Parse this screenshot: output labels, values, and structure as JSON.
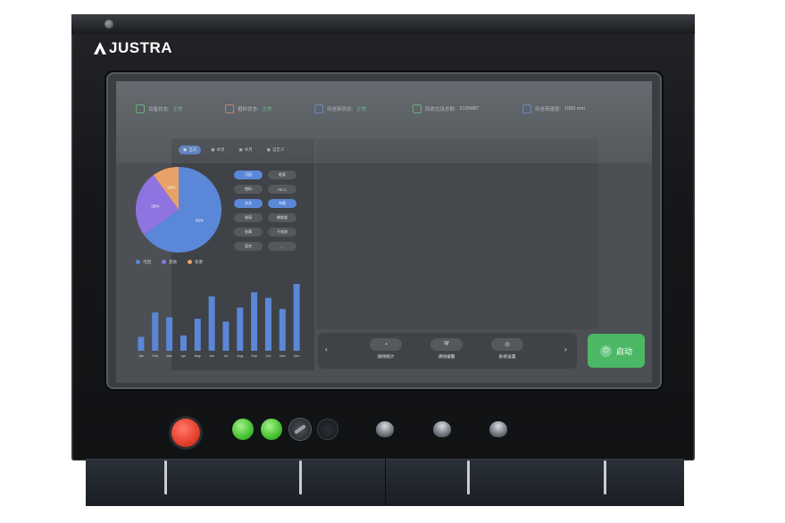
{
  "brand": {
    "logo_text": "JUSTRA"
  },
  "status_bar": [
    {
      "label": "设备状态:",
      "value": "正常",
      "icon": "device-icon",
      "icon_color": "#5ac26c",
      "value_style": "ok"
    },
    {
      "label": "粗料状态:",
      "value": "正常",
      "icon": "material-icon",
      "icon_color": "#e0894a",
      "value_style": "ok"
    },
    {
      "label": "传送带状态:",
      "value": "正常",
      "icon": "info-icon",
      "icon_color": "#5b87d8",
      "value_style": "ok"
    },
    {
      "label": "回收垃圾总数:",
      "value": "2135487",
      "icon": "recycle-icon",
      "icon_color": "#5ac26c",
      "value_style": "plain"
    },
    {
      "label": "传送带速度:",
      "value": "1000 mm",
      "icon": "speed-icon",
      "icon_color": "#5b87d8",
      "value_style": "plain"
    }
  ],
  "tabs": [
    {
      "label": "当天",
      "active": true
    },
    {
      "label": "本周",
      "active": false
    },
    {
      "label": "本月",
      "active": false
    },
    {
      "label": "自定义",
      "active": false
    }
  ],
  "pie_chart": {
    "slices": [
      {
        "name": "可回",
        "value": 65,
        "label": "65%",
        "color": "#5b87d8"
      },
      {
        "name": "其他",
        "value": 25,
        "label": "25%",
        "color": "#8f73e0"
      },
      {
        "name": "有害",
        "value": 10,
        "label": "10%",
        "color": "#e8a267"
      }
    ]
  },
  "legend": [
    {
      "label": "可回",
      "color": "#5b87d8"
    },
    {
      "label": "其他",
      "color": "#8f73e0"
    },
    {
      "label": "有害",
      "color": "#e8a267"
    }
  ],
  "category_buttons": [
    {
      "label": "可回",
      "on": true
    },
    {
      "label": "纸类",
      "on": false
    },
    {
      "label": "塑料",
      "on": false
    },
    {
      "label": "PE-C",
      "on": false
    },
    {
      "label": "木头",
      "on": true
    },
    {
      "label": "布类",
      "on": true
    },
    {
      "label": "玻璃",
      "on": false
    },
    {
      "label": "橡胶类",
      "on": false
    },
    {
      "label": "金属",
      "on": false
    },
    {
      "label": "干电池",
      "on": false
    },
    {
      "label": "混合",
      "on": false
    },
    {
      "label": "...",
      "on": false
    }
  ],
  "chart_data": {
    "type": "bar",
    "categories": [
      "Jan",
      "Feb",
      "Mar",
      "Apr",
      "May",
      "Jun",
      "Jul",
      "Aug",
      "Sep",
      "Oct",
      "Nov",
      "Dec"
    ],
    "values": [
      20,
      55,
      48,
      22,
      46,
      78,
      42,
      62,
      84,
      76,
      60,
      96
    ],
    "ylim": [
      0,
      100
    ],
    "color": "#5b87d8"
  },
  "bottom_nav": {
    "prev_label": "‹",
    "next_label": "›",
    "items": [
      {
        "label": "清除统计",
        "icon": "clear-icon"
      },
      {
        "label": "清除报警",
        "icon": "alarm-icon"
      },
      {
        "label": "系统设置",
        "icon": "settings-icon"
      }
    ]
  },
  "start_button": {
    "label": "启动",
    "icon": "power-icon"
  }
}
